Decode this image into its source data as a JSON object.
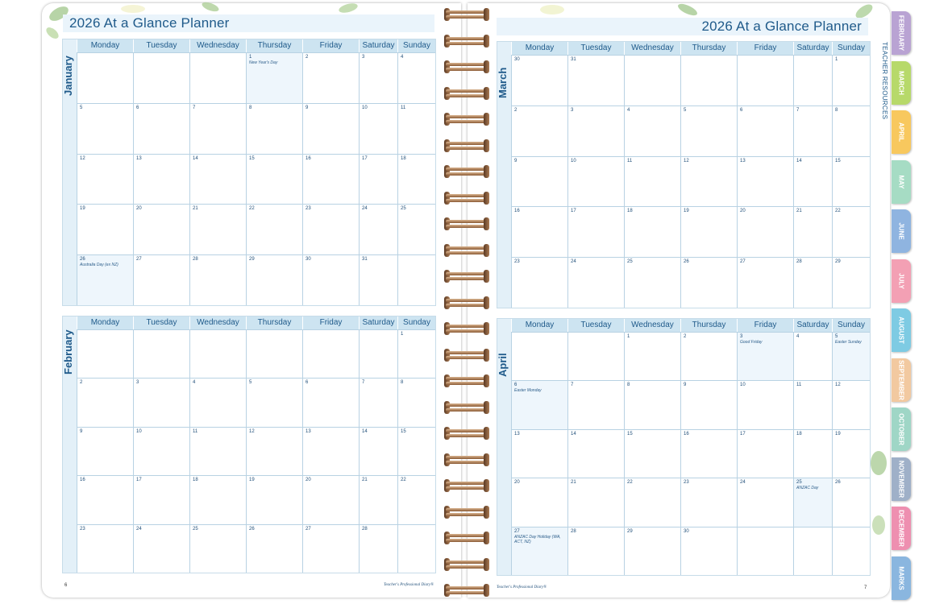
{
  "left_page": {
    "title": "2026 At a Glance Planner",
    "page_number": "6",
    "footer": "Teacher's Professional Diary®"
  },
  "right_page": {
    "title": "2026 At a Glance Planner",
    "page_number": "7",
    "footer": "Teacher's Professional Diary®",
    "side_label": "TEACHER RESOURCES"
  },
  "weekdays": [
    "Monday",
    "Tuesday",
    "Wednesday",
    "Thursday",
    "Friday",
    "Saturday",
    "Sunday"
  ],
  "months": [
    {
      "name": "January",
      "weeks": [
        [
          "",
          "",
          "",
          "1",
          "2",
          "3",
          "4"
        ],
        [
          "5",
          "6",
          "7",
          "8",
          "9",
          "10",
          "11"
        ],
        [
          "12",
          "13",
          "14",
          "15",
          "16",
          "17",
          "18"
        ],
        [
          "19",
          "20",
          "21",
          "22",
          "23",
          "24",
          "25"
        ],
        [
          "26",
          "27",
          "28",
          "29",
          "30",
          "31",
          ""
        ]
      ],
      "events": [
        {
          "week": 0,
          "day": 3,
          "text": "New Year's Day"
        },
        {
          "week": 4,
          "day": 0,
          "text": "Australia Day (ex NZ)"
        }
      ]
    },
    {
      "name": "February",
      "weeks": [
        [
          "",
          "",
          "",
          "",
          "",
          "",
          "1"
        ],
        [
          "2",
          "3",
          "4",
          "5",
          "6",
          "7",
          "8"
        ],
        [
          "9",
          "10",
          "11",
          "12",
          "13",
          "14",
          "15"
        ],
        [
          "16",
          "17",
          "18",
          "19",
          "20",
          "21",
          "22"
        ],
        [
          "23",
          "24",
          "25",
          "26",
          "27",
          "28",
          ""
        ]
      ],
      "events": []
    },
    {
      "name": "March",
      "weeks": [
        [
          "30",
          "31",
          "",
          "",
          "",
          "",
          "1"
        ],
        [
          "2",
          "3",
          "4",
          "5",
          "6",
          "7",
          "8"
        ],
        [
          "9",
          "10",
          "11",
          "12",
          "13",
          "14",
          "15"
        ],
        [
          "16",
          "17",
          "18",
          "19",
          "20",
          "21",
          "22"
        ],
        [
          "23",
          "24",
          "25",
          "26",
          "27",
          "28",
          "29"
        ]
      ],
      "events": []
    },
    {
      "name": "April",
      "weeks": [
        [
          "",
          "",
          "1",
          "2",
          "3",
          "4",
          "5"
        ],
        [
          "6",
          "7",
          "8",
          "9",
          "10",
          "11",
          "12"
        ],
        [
          "13",
          "14",
          "15",
          "16",
          "17",
          "18",
          "19"
        ],
        [
          "20",
          "21",
          "22",
          "23",
          "24",
          "25",
          "26"
        ],
        [
          "27",
          "28",
          "29",
          "30",
          "",
          "",
          ""
        ]
      ],
      "events": [
        {
          "week": 0,
          "day": 4,
          "text": "Good Friday"
        },
        {
          "week": 0,
          "day": 6,
          "text": "Easter Sunday"
        },
        {
          "week": 1,
          "day": 0,
          "text": "Easter Monday"
        },
        {
          "week": 3,
          "day": 5,
          "text": "ANZAC Day"
        },
        {
          "week": 4,
          "day": 0,
          "text": "ANZAC Day Holiday (WA, ACT, NZ)"
        }
      ]
    }
  ],
  "tabs": [
    {
      "label": "FEBRUARY",
      "color": "#b9a3d3"
    },
    {
      "label": "MARCH",
      "color": "#b7d96a"
    },
    {
      "label": "APRIL",
      "color": "#f8c85e"
    },
    {
      "label": "MAY",
      "color": "#a6dcc4"
    },
    {
      "label": "JUNE",
      "color": "#8fb4e0"
    },
    {
      "label": "JULY",
      "color": "#f3a0b4"
    },
    {
      "label": "AUGUST",
      "color": "#7ecbe3"
    },
    {
      "label": "SEPTEMBER",
      "color": "#f2c9a0"
    },
    {
      "label": "OCTOBER",
      "color": "#9fd6c6"
    },
    {
      "label": "NOVEMBER",
      "color": "#9fb0c8"
    },
    {
      "label": "DECEMBER",
      "color": "#ee8fb0"
    },
    {
      "label": "MARKS",
      "color": "#8ab6df"
    }
  ]
}
